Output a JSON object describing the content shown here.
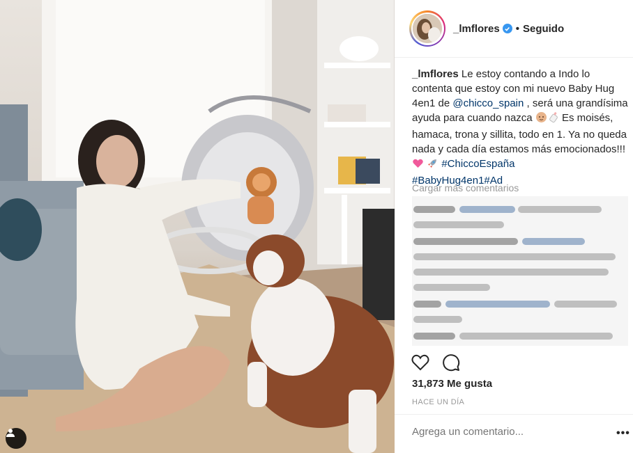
{
  "photo": {
    "alt_icon": "user-tag-icon"
  },
  "header": {
    "username": "_lmflores",
    "verified_icon": "verified-badge-icon",
    "separator": "•",
    "follow_state": "Seguido"
  },
  "caption": {
    "username": "_lmflores",
    "text_1": "Le estoy contando a Indo lo contenta que estoy con mi nuevo Baby Hug 4en1 de",
    "mention": "@chicco_spain",
    "text_2": ", será una grandísima ayuda para cuando nazca",
    "text_3": "Es moisés, hamaca, trona y sillita, todo en 1. Ya no queda nada y cada día estamos más emocionados!!!",
    "hashtag_1": "#ChiccoEspaña",
    "hashtag_2": "#BabyHug4en1",
    "hashtag_3": "#Ad"
  },
  "comments": {
    "load_more": "Cargar más comentarios"
  },
  "actions": {
    "like_icon": "heart-icon",
    "comment_icon": "comment-icon"
  },
  "likes": "31,873 Me gusta",
  "timestamp": "HACE UN DÍA",
  "add_comment": {
    "placeholder": "Agrega un comentario..."
  },
  "more_label": "•••",
  "colors": {
    "link": "#003569",
    "verified": "#3897f0",
    "muted": "#999999",
    "text": "#262626"
  }
}
